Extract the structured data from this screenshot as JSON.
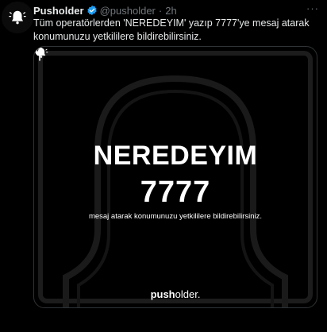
{
  "tweet": {
    "author_name": "Pusholder",
    "author_handle": "@pusholder",
    "separator": "·",
    "time": "2h",
    "more_label": "···",
    "text": "Tüm operatörlerden 'NEREDEYIM' yazıp 7777'ye mesaj atarak konumunuzu yetkililere bildirebilirsiniz."
  },
  "media": {
    "headline": "NEREDEYIM",
    "number": "7777",
    "subtitle": "mesaj atarak konumunuzu yetkililere bildirebilirsiniz.",
    "brand_bold": "push",
    "brand_rest": "older."
  },
  "colors": {
    "background": "#000000",
    "text": "#e7e9ea",
    "muted": "#71767b",
    "verified": "#1d9bf0",
    "border": "#2f3336"
  },
  "icons": {
    "avatar": "bell-icon",
    "verified": "verified-badge-icon",
    "pin": "map-pin-icon",
    "brand": "bell-icon"
  }
}
